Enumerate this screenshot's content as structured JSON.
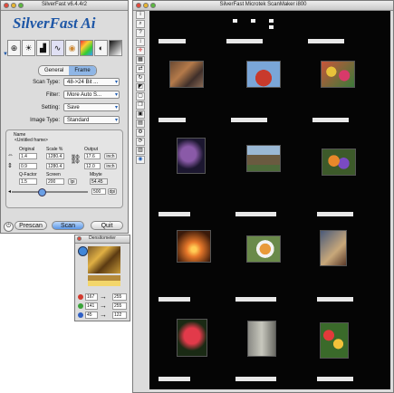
{
  "palette": {
    "title": "SilverFast v6.4.4r2",
    "logo": "SilverFast Ai",
    "tools": [
      "magnifier-icon",
      "sun-icon",
      "histogram-icon",
      "curve-icon",
      "color-wheel-icon",
      "rainbow-icon",
      "selective-color-icon",
      "gradation-icon"
    ],
    "tabs": [
      {
        "label": "General",
        "active": false
      },
      {
        "label": "Frame",
        "active": true
      }
    ],
    "scan_type": {
      "label": "Scan Type:",
      "value": "48->24 Bit ..."
    },
    "filter": {
      "label": "Filter:",
      "value": "More Auto S..."
    },
    "setting": {
      "label": "Setting:",
      "value": "Save"
    },
    "image_type": {
      "label": "Image Type:",
      "value": "Standard"
    },
    "frame": {
      "name_label": "Name",
      "name_value": "<Untitled frame>",
      "original_label": "Original",
      "scale_label": "Scale %",
      "output_label": "Output",
      "orig_w": "1.4",
      "orig_h": "0.9",
      "scale_w": "1280.4",
      "scale_h": "1280.4",
      "out_w": "17.6",
      "out_h": "12.0",
      "unit1": "inch",
      "unit2": "inch",
      "qfactor_label": "Q-Factor",
      "screen_label": "Screen",
      "mbyte_label": "Mbyte",
      "qfactor": "1.5",
      "screen": "200",
      "screen_unit": "lpi",
      "mbyte": "54.45",
      "res": "500",
      "res_unit": "dpi"
    },
    "buttons": {
      "prescan": "Prescan",
      "scan": "Scan",
      "quit": "Quit"
    }
  },
  "densitometer": {
    "title": "Densitometer",
    "rows": [
      {
        "color": "#d23a2e",
        "before": "167",
        "after": "255"
      },
      {
        "color": "#3aa33a",
        "before": "141",
        "after": "255"
      },
      {
        "color": "#2f5fc4",
        "before": "45",
        "after": "122"
      }
    ]
  },
  "preview": {
    "title": "SilverFast Microtek ScanMaker i800",
    "side_tools": [
      "info-icon",
      "loupe-icon",
      "help-icon",
      "expand-icon",
      "crosshair-icon",
      "grid-icon",
      "flip-icon",
      "rotate-icon",
      "negative-icon",
      "frame-icon",
      "copy-icon",
      "dust-icon",
      "prefs-icon",
      "settings-icon",
      "rescan-icon",
      "film-icon",
      "eye-icon"
    ],
    "thumbs": [
      "Street scene, rusty metal",
      "Red circus tent, blue sky",
      "Colorful flower bed",
      "Dark purple blossoms",
      "House with trees",
      "Orange and purple flowers",
      "Sunset silhouette tree",
      "Butterfly on flower",
      "Wooden pier",
      "Red lily flower",
      "Weathered building",
      "Colorful tulips"
    ]
  }
}
